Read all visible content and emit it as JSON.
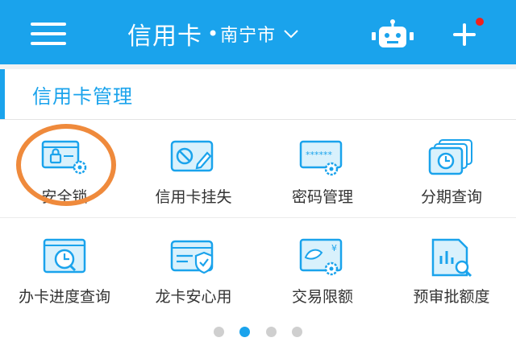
{
  "header": {
    "title": "信用卡",
    "separator": "•",
    "city": "南宁市",
    "icons": {
      "menu": "menu-icon",
      "city_dropdown": "chevron-down-icon",
      "assistant": "robot-icon",
      "add": "plus-icon",
      "notification": "red-dot-badge"
    }
  },
  "section": {
    "title": "信用卡管理"
  },
  "grid": [
    {
      "label": "安全锁",
      "icon": "card-lock-gear-icon"
    },
    {
      "label": "信用卡挂失",
      "icon": "card-report-loss-icon"
    },
    {
      "label": "密码管理",
      "icon": "password-gear-icon"
    },
    {
      "label": "分期查询",
      "icon": "installment-clock-icon"
    },
    {
      "label": "办卡进度查询",
      "icon": "progress-clock-icon"
    },
    {
      "label": "龙卡安心用",
      "icon": "card-shield-icon"
    },
    {
      "label": "交易限额",
      "icon": "transaction-limit-icon"
    },
    {
      "label": "预审批额度",
      "icon": "preapproval-chart-icon"
    }
  ],
  "pager": {
    "total": 4,
    "active_index": 1
  },
  "colors": {
    "brand": "#1aa3ec",
    "highlight": "#ef8a3c",
    "badge": "#f0211c",
    "label": "#333333"
  }
}
